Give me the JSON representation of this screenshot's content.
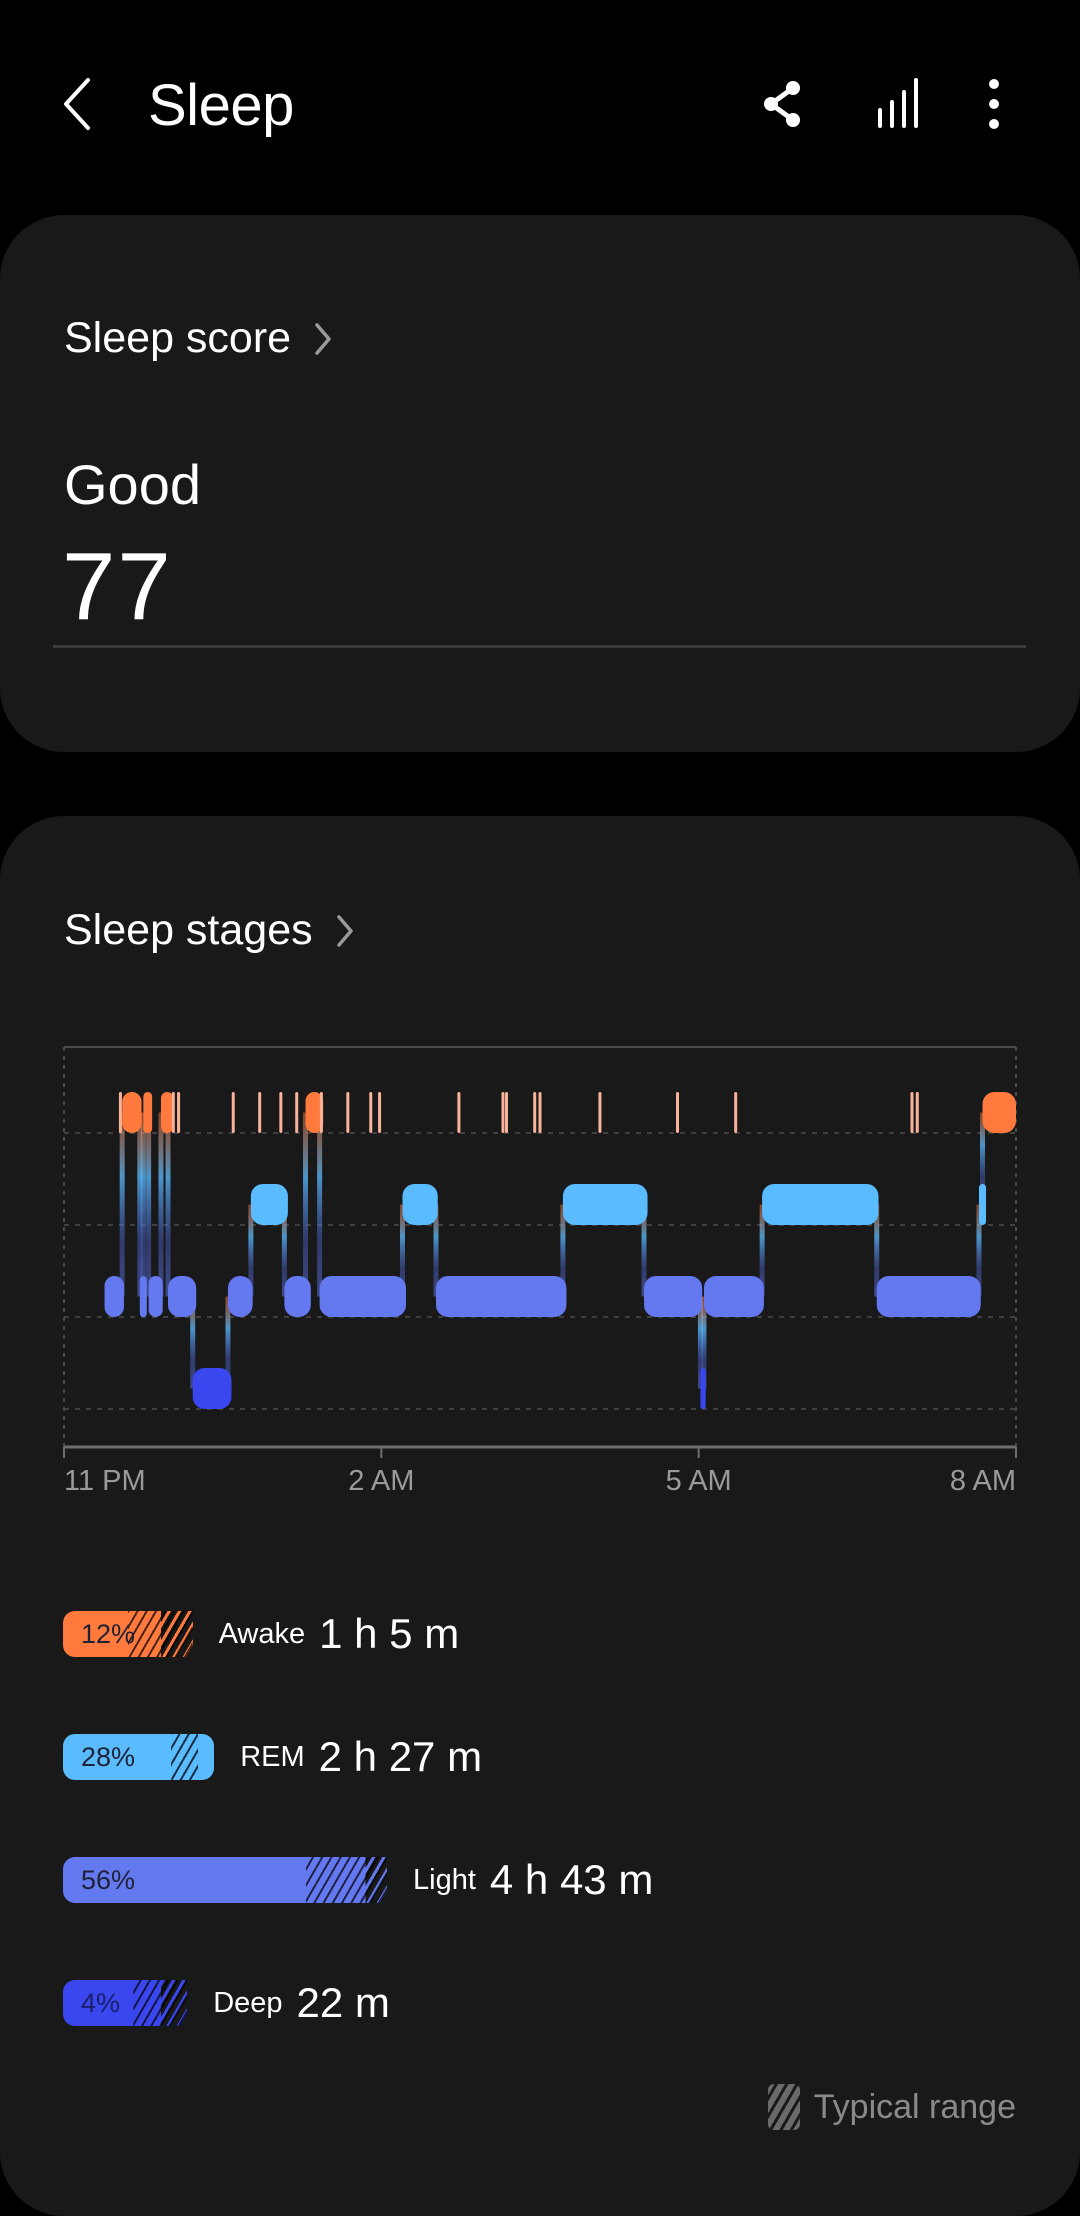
{
  "appbar": {
    "title": "Sleep",
    "actions": [
      "share-icon",
      "chart-bars-icon",
      "more-vertical-icon"
    ]
  },
  "score_card": {
    "header": "Sleep score",
    "rating": "Good",
    "score": "77"
  },
  "stages_card": {
    "header": "Sleep stages",
    "x_ticks": [
      "11 PM",
      "2 AM",
      "5 AM",
      "8 AM"
    ],
    "stages": [
      {
        "key": "awake",
        "name": "Awake",
        "percent": "12%",
        "percent_value": 12,
        "duration": "1 h 5 m",
        "color": "#FF7A3C",
        "typical_range_pct": [
          12,
          24
        ]
      },
      {
        "key": "rem",
        "name": "REM",
        "percent": "28%",
        "percent_value": 28,
        "duration": "2 h 27 m",
        "color": "#5BBBFF",
        "typical_range_pct": [
          20,
          25
        ]
      },
      {
        "key": "light",
        "name": "Light",
        "percent": "56%",
        "percent_value": 56,
        "duration": "4 h 43 m",
        "color": "#6478EF",
        "typical_range_pct": [
          45,
          60
        ]
      },
      {
        "key": "deep",
        "name": "Deep",
        "percent": "4%",
        "percent_value": 4,
        "duration": "22 m",
        "color": "#3A46EE",
        "typical_range_pct": [
          13,
          23
        ]
      }
    ],
    "typical_range_label": "Typical range"
  },
  "chart_data": {
    "type": "hypnogram",
    "title": "Sleep stages",
    "xlabel": "",
    "ylabel": "",
    "x_ticks": [
      "11 PM",
      "2 AM",
      "5 AM",
      "8 AM"
    ],
    "x_range_minutes_from_11pm": [
      0,
      540
    ],
    "levels": [
      "Awake",
      "REM",
      "Light",
      "Deep"
    ],
    "grid": true,
    "segments": [
      {
        "stage": "Light",
        "start": 23,
        "end": 34
      },
      {
        "stage": "Awake",
        "start": 33,
        "end": 44
      },
      {
        "stage": "Light",
        "start": 43,
        "end": 47
      },
      {
        "stage": "Awake",
        "start": 45,
        "end": 50
      },
      {
        "stage": "Light",
        "start": 48,
        "end": 56
      },
      {
        "stage": "Awake",
        "start": 55,
        "end": 62
      },
      {
        "stage": "Light",
        "start": 59,
        "end": 75
      },
      {
        "stage": "Deep",
        "start": 73,
        "end": 95
      },
      {
        "stage": "Light",
        "start": 93,
        "end": 107
      },
      {
        "stage": "REM",
        "start": 106,
        "end": 127
      },
      {
        "stage": "Light",
        "start": 125,
        "end": 140
      },
      {
        "stage": "Awake",
        "start": 137,
        "end": 147
      },
      {
        "stage": "Light",
        "start": 145,
        "end": 194
      },
      {
        "stage": "REM",
        "start": 192,
        "end": 212
      },
      {
        "stage": "Light",
        "start": 211,
        "end": 285
      },
      {
        "stage": "REM",
        "start": 283,
        "end": 331
      },
      {
        "stage": "Light",
        "start": 329,
        "end": 362
      },
      {
        "stage": "Deep",
        "start": 361,
        "end": 364
      },
      {
        "stage": "Light",
        "start": 363,
        "end": 397
      },
      {
        "stage": "REM",
        "start": 396,
        "end": 462
      },
      {
        "stage": "Light",
        "start": 461,
        "end": 520
      },
      {
        "stage": "REM",
        "start": 519,
        "end": 523
      },
      {
        "stage": "Awake",
        "start": 521,
        "end": 540
      }
    ],
    "brief_awakenings_minutes": [
      32,
      62,
      65,
      96,
      111,
      123,
      132,
      146,
      161,
      174,
      179,
      224,
      249,
      251,
      267,
      270,
      304,
      348,
      381,
      481,
      484
    ]
  }
}
